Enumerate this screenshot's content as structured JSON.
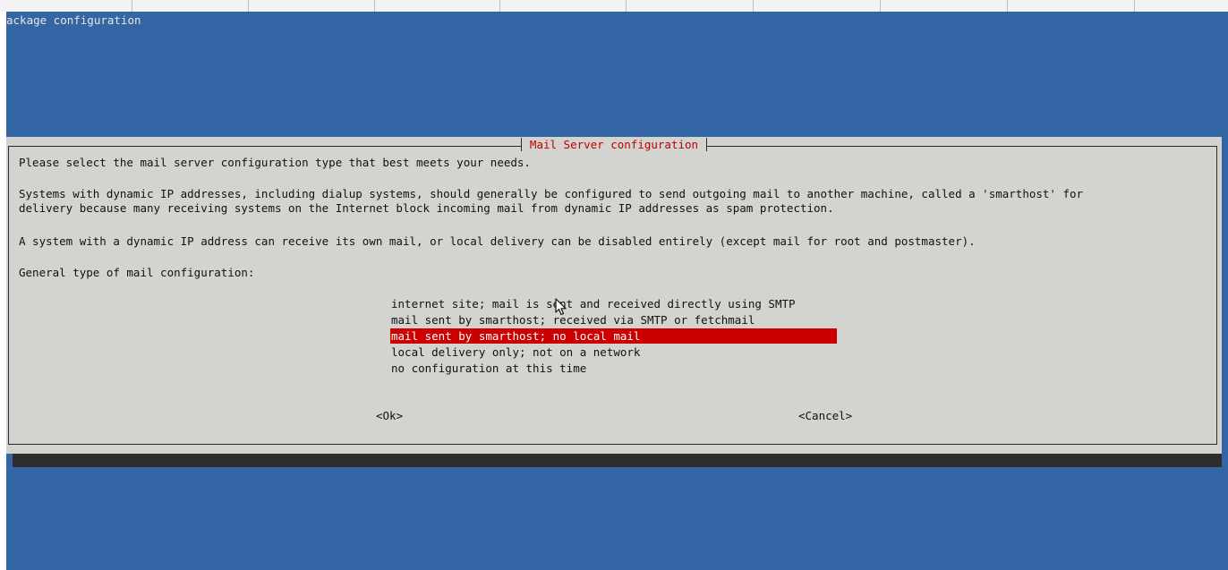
{
  "backtitle": "ackage configuration",
  "dialog": {
    "title": "Mail Server configuration",
    "lines": [
      "Please select the mail server configuration type that best meets your needs.",
      "Systems with dynamic IP addresses, including dialup systems, should generally be configured to send outgoing mail to another machine, called a 'smarthost' for",
      "delivery because many receiving systems on the Internet block incoming mail from dynamic IP addresses as spam protection.",
      "A system with a dynamic IP address can receive its own mail, or local delivery can be disabled entirely (except mail for root and postmaster).",
      "General type of mail configuration:"
    ],
    "options": [
      "internet site; mail is sent and received directly using SMTP",
      "mail sent by smarthost; received via SMTP or fetchmail",
      "mail sent by smarthost; no local mail",
      "local delivery only; not on a network",
      "no configuration at this time"
    ],
    "selected_option": "mail sent by smarthost; no local mail",
    "ok_label": "<Ok>",
    "cancel_label": "<Cancel>"
  },
  "colors": {
    "terminal_background": "#3465a4",
    "dialog_background": "#d3d3cf",
    "title_text": "#c00000",
    "selection": "#cc0000"
  },
  "icons": {
    "cursor": "mouse-pointer-icon"
  }
}
